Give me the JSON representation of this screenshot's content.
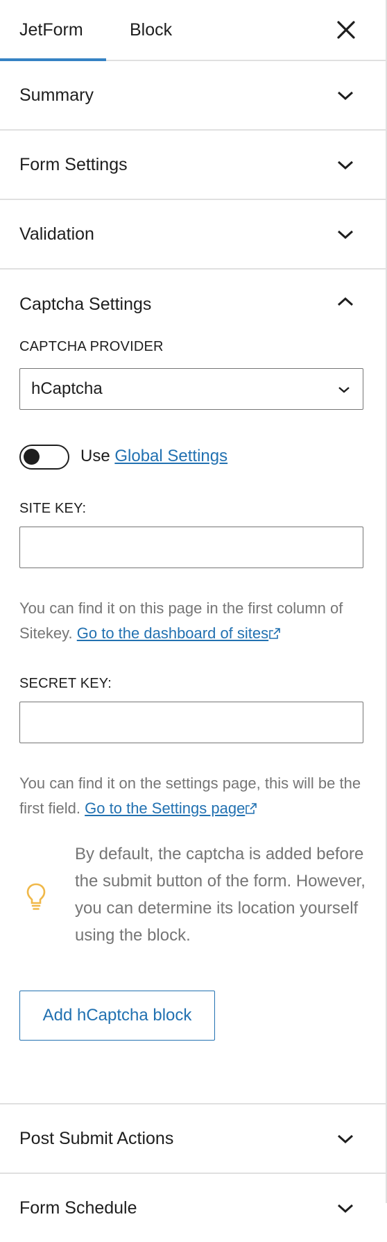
{
  "tabs": [
    {
      "label": "JetForm",
      "active": true
    },
    {
      "label": "Block",
      "active": false
    }
  ],
  "close": {
    "icon": "close-icon"
  },
  "panels": {
    "summary": {
      "title": "Summary",
      "expanded": false
    },
    "form_settings": {
      "title": "Form Settings",
      "expanded": false
    },
    "validation": {
      "title": "Validation",
      "expanded": false
    },
    "captcha": {
      "title": "Captcha Settings",
      "expanded": true,
      "provider_label": "CAPTCHA PROVIDER",
      "provider_value": "hCaptcha",
      "toggle": {
        "on": false,
        "label_prefix": "Use",
        "link_text": "Global Settings"
      },
      "site_key": {
        "label": "SITE KEY:",
        "value": "",
        "help_text": "You can find it on this page in the first column of Sitekey.",
        "link_text": "Go to the dashboard of sites"
      },
      "secret_key": {
        "label": "SECRET KEY:",
        "value": "",
        "help_text": "You can find it on the settings page, this will be the first field.",
        "link_text": "Go to the Settings page"
      },
      "notice": {
        "icon": "lightbulb-icon",
        "text": "By default, the captcha is added before the submit button of the form. However, you can determine its location yourself using the block."
      },
      "add_button": "Add hCaptcha block"
    },
    "post_submit": {
      "title": "Post Submit Actions",
      "expanded": false
    },
    "form_schedule": {
      "title": "Form Schedule",
      "expanded": false
    }
  },
  "colors": {
    "accent": "#2271b1",
    "tab_indicator": "#3582c4",
    "border": "#e0e0e0",
    "muted_text": "#757575",
    "bulb": "#f0b849"
  }
}
